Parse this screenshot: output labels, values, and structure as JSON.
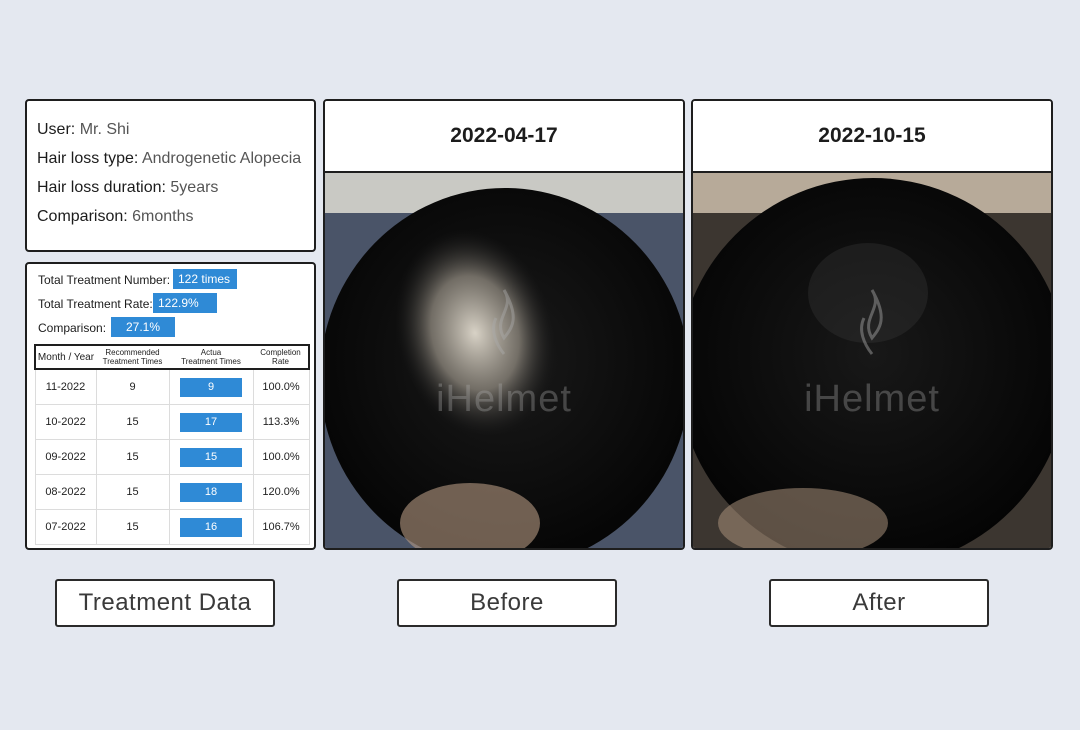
{
  "info": {
    "user_label": "User:",
    "user_value": "Mr. Shi",
    "type_label": "Hair loss type:",
    "type_value": "Androgenetic Alopecia",
    "duration_label": "Hair loss duration:",
    "duration_value": "5years",
    "comparison_label": "Comparison:",
    "comparison_value": "6months"
  },
  "stats": {
    "total_number_label": "Total Treatment Number:",
    "total_number_value": "122 times",
    "total_rate_label": "Total Treatment Rate:",
    "total_rate_value": "122.9%",
    "comparison_label": "Comparison:",
    "comparison_value": "27.1%"
  },
  "table": {
    "headers": [
      "Month / Year",
      "Recommended\nTreatment Times",
      "Actua\nTreatment Times",
      "Completion\nRate"
    ],
    "rows": [
      {
        "month": "11-2022",
        "recommended": "9",
        "actual": "9",
        "rate": "100.0%"
      },
      {
        "month": "10-2022",
        "recommended": "15",
        "actual": "17",
        "rate": "113.3%"
      },
      {
        "month": "09-2022",
        "recommended": "15",
        "actual": "15",
        "rate": "100.0%"
      },
      {
        "month": "08-2022",
        "recommended": "15",
        "actual": "18",
        "rate": "120.0%"
      },
      {
        "month": "07-2022",
        "recommended": "15",
        "actual": "16",
        "rate": "106.7%"
      }
    ]
  },
  "before": {
    "date": "2022-04-17",
    "watermark": "iHelmet"
  },
  "after": {
    "date": "2022-10-15",
    "watermark": "iHelmet"
  },
  "captions": {
    "data": "Treatment Data",
    "before": "Before",
    "after": "After"
  },
  "colors": {
    "accent_blue": "#2f8ad6",
    "background": "#e4e8f0",
    "border": "#1e1e1e"
  }
}
